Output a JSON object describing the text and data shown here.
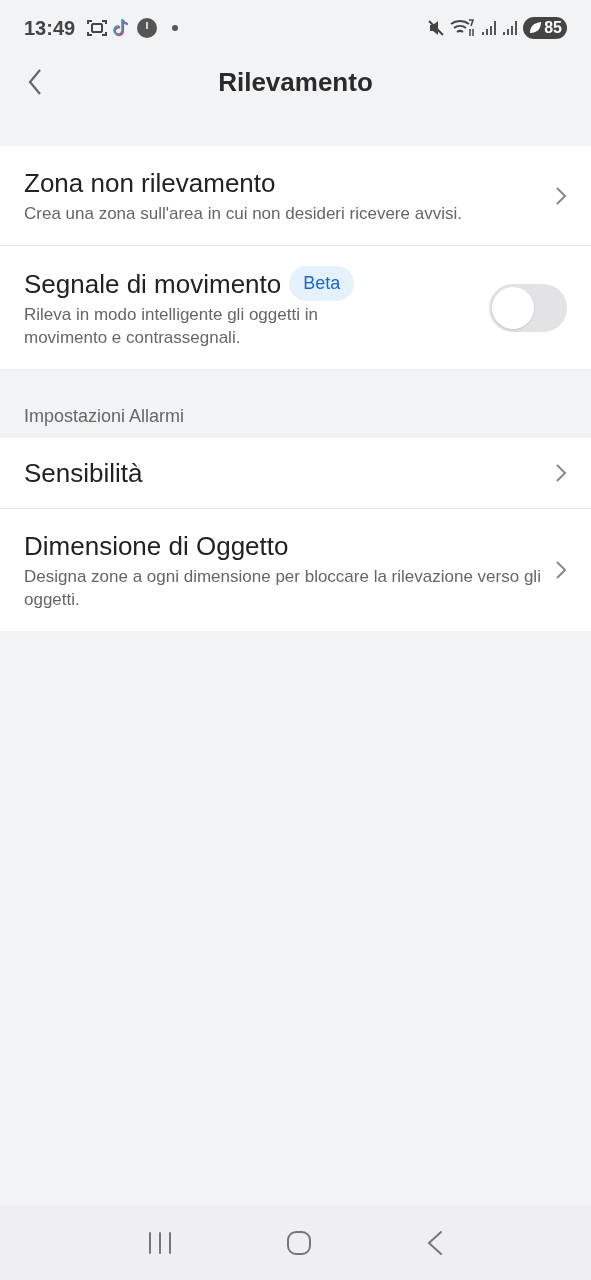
{
  "status_bar": {
    "time": "13:49",
    "battery": "85"
  },
  "header": {
    "title": "Rilevamento"
  },
  "sections": [
    {
      "items": [
        {
          "kind": "link",
          "title": "Zona non rilevamento",
          "subtitle": "Crea una zona sull'area in cui non desideri ricevere avvisi."
        },
        {
          "kind": "toggle",
          "title": "Segnale di movimento",
          "badge": "Beta",
          "subtitle": "Rileva in modo intelligente gli oggetti in movimento e contrassegnali.",
          "on": false
        }
      ]
    },
    {
      "header": "Impostazioni Allarmi",
      "items": [
        {
          "kind": "link",
          "title": "Sensibilità"
        },
        {
          "kind": "link",
          "title": "Dimensione di Oggetto",
          "subtitle": "Designa zone a ogni dimensione per bloccare la rilevazione verso gli oggetti."
        }
      ]
    }
  ]
}
